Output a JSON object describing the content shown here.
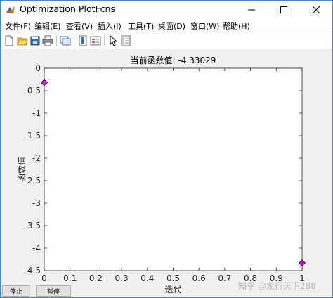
{
  "window": {
    "title": "Optimization PlotFcns",
    "app_icon": "matlab-icon",
    "controls": [
      "minimize-icon",
      "maximize-icon",
      "close-icon"
    ]
  },
  "menu": {
    "items": [
      "文件(F)",
      "编辑(E)",
      "查看(V)",
      "插入(I)",
      "工具(T)",
      "桌面(D)",
      "窗口(W)",
      "帮助(H)"
    ]
  },
  "toolbar": {
    "icons": [
      "new-figure-icon",
      "open-file-icon",
      "save-icon",
      "print-icon",
      "link-plot-icon",
      "insert-colorbar-icon",
      "insert-legend-icon",
      "edit-plot-arrow-icon",
      "property-inspector-icon"
    ]
  },
  "chart_data": {
    "type": "scatter",
    "title": "当前函数值: -4.33029",
    "xlabel": "迭代",
    "ylabel": "函数值",
    "x": [
      0,
      1
    ],
    "y": [
      -0.32,
      -4.33029
    ],
    "xlim": [
      0,
      1
    ],
    "ylim": [
      -4.5,
      0
    ],
    "xticks": [
      "0",
      "0.1",
      "0.2",
      "0.3",
      "0.4",
      "0.5",
      "0.6",
      "0.7",
      "0.8",
      "0.9",
      "1"
    ],
    "yticks": [
      "0",
      "-0.5",
      "-1",
      "-1.5",
      "-2",
      "-2.5",
      "-3",
      "-3.5",
      "-4",
      "-4.5"
    ],
    "marker": "diamond",
    "marker_color": "#d400d4",
    "grid": false
  },
  "buttons": {
    "stop": "停止",
    "pause": "暂停"
  },
  "watermark": "知乎 @龙行天下288"
}
